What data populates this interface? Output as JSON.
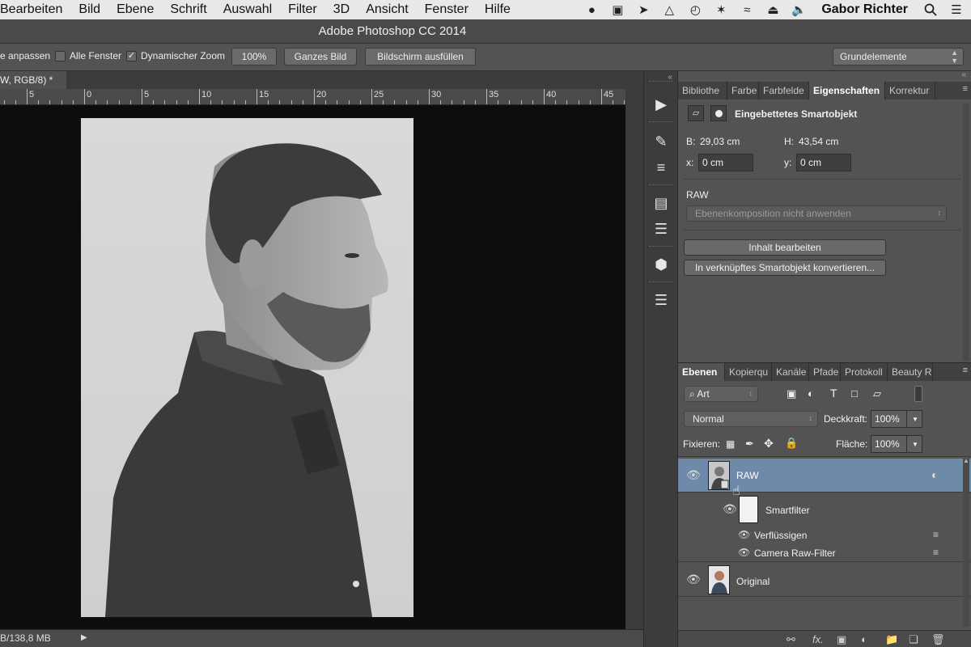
{
  "menubar": {
    "menus": [
      "Bearbeiten",
      "Bild",
      "Ebene",
      "Schrift",
      "Auswahl",
      "Filter",
      "3D",
      "Ansicht",
      "Fenster",
      "Hilfe"
    ],
    "user": "Gabor Richter"
  },
  "window": {
    "title": "Adobe Photoshop CC 2014"
  },
  "options": {
    "fit_label": "e anpassen",
    "all_windows_label": "Alle Fenster",
    "all_windows_checked": false,
    "dynamic_zoom_label": "Dynamischer Zoom",
    "dynamic_zoom_checked": true,
    "zoom_100_label": "100%",
    "fit_screen_label": "Ganzes Bild",
    "fill_screen_label": "Bildschirm ausfüllen",
    "workspace": "Grundelemente"
  },
  "document": {
    "tab_label": "W, RGB/8) *",
    "ruler_labels": [
      "5",
      "0",
      "5",
      "10",
      "15",
      "20",
      "25",
      "30",
      "35",
      "40",
      "45"
    ],
    "status_text": "B/138,8 MB"
  },
  "properties_panel": {
    "tabs": [
      "Bibliothe",
      "Farbe",
      "Farbfelde",
      "Eigenschaften",
      "Korrektur"
    ],
    "active_tab": "Eigenschaften",
    "header": "Eingebettetes Smartobjekt",
    "width_label": "B:",
    "width_value": "29,03 cm",
    "height_label": "H:",
    "height_value": "43,54 cm",
    "x_label": "x:",
    "x_value": "0 cm",
    "y_label": "y:",
    "y_value": "0 cm",
    "source_name": "RAW",
    "comp_placeholder": "Ebenenkomposition nicht anwenden",
    "edit_button": "Inhalt bearbeiten",
    "convert_button": "In verknüpftes Smartobjekt konvertieren..."
  },
  "layers_panel": {
    "tabs": [
      "Ebenen",
      "Kopierqu",
      "Kanäle",
      "Pfade",
      "Protokoll",
      "Beauty R"
    ],
    "active_tab": "Ebenen",
    "filter_kind": "Art",
    "blend_mode": "Normal",
    "opacity_label": "Deckkraft:",
    "opacity_value": "100%",
    "lock_label": "Fixieren:",
    "fill_label": "Fläche:",
    "fill_value": "100%",
    "layers": [
      {
        "name": "RAW",
        "selected": true
      },
      {
        "name": "Smartfilter"
      },
      {
        "name": "Verflüssigen"
      },
      {
        "name": "Camera Raw-Filter"
      },
      {
        "name": "Original"
      }
    ]
  }
}
